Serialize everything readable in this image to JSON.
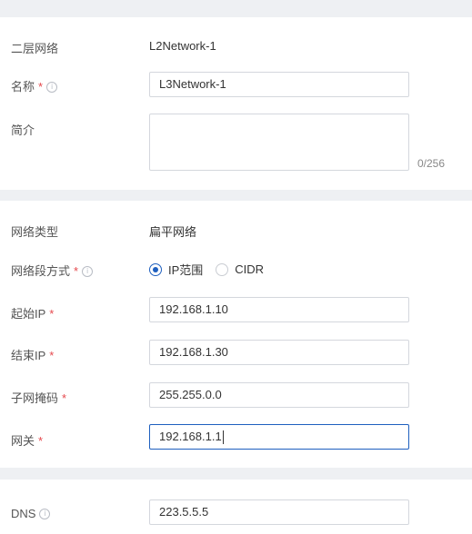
{
  "section1": {
    "l2_label": "二层网络",
    "l2_value": "L2Network-1",
    "name_label": "名称",
    "name_value": "L3Network-1",
    "desc_label": "简介",
    "desc_value": "",
    "desc_counter": "0/256"
  },
  "section2": {
    "type_label": "网络类型",
    "type_value": "扁平网络",
    "mode_label": "网络段方式",
    "mode_options": [
      {
        "label": "IP范围",
        "selected": true
      },
      {
        "label": "CIDR",
        "selected": false
      }
    ],
    "start_ip_label": "起始IP",
    "start_ip_value": "192.168.1.10",
    "end_ip_label": "结束IP",
    "end_ip_value": "192.168.1.30",
    "netmask_label": "子网掩码",
    "netmask_value": "255.255.0.0",
    "gateway_label": "网关",
    "gateway_value": "192.168.1.1"
  },
  "section3": {
    "dns_label": "DNS",
    "dns_value": "223.5.5.5"
  },
  "common": {
    "required_mark": "*",
    "info_glyph": "i"
  },
  "colors": {
    "accent": "#1e5fbf",
    "required": "#e5484d",
    "background": "#eef0f3"
  }
}
